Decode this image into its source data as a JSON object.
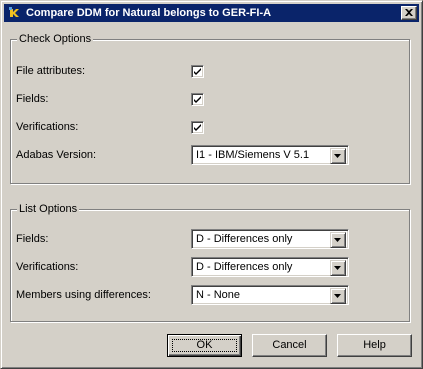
{
  "window": {
    "title": "Compare DDM for Natural belongs to GER-FI-A",
    "icon": "natural-app-icon",
    "close_icon": "close-icon"
  },
  "check_options": {
    "legend": "Check Options",
    "items": [
      {
        "label": "File attributes:",
        "checked": true
      },
      {
        "label": "Fields:",
        "checked": true
      },
      {
        "label": "Verifications:",
        "checked": true
      }
    ],
    "adabas_version": {
      "label": "Adabas Version:",
      "value": "I1 - IBM/Siemens V 5.1"
    }
  },
  "list_options": {
    "legend": "List Options",
    "fields": {
      "label": "Fields:",
      "value": "D - Differences only"
    },
    "verifications": {
      "label": "Verifications:",
      "value": "D - Differences only"
    },
    "members": {
      "label": "Members using differences:",
      "value": "N - None"
    }
  },
  "buttons": {
    "ok": "OK",
    "cancel": "Cancel",
    "help": "Help"
  },
  "colors": {
    "title_bar": "#0a246a",
    "face": "#d4d0c8"
  }
}
